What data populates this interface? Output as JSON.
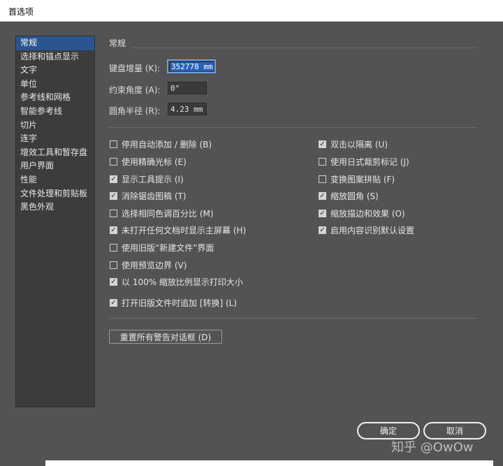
{
  "window": {
    "title": "首选项"
  },
  "sidebar": {
    "items": [
      {
        "label": "常规",
        "selected": true
      },
      {
        "label": "选择和锚点显示"
      },
      {
        "label": "文字"
      },
      {
        "label": "单位"
      },
      {
        "label": "参考线和网格"
      },
      {
        "label": "智能参考线"
      },
      {
        "label": "切片"
      },
      {
        "label": "连字"
      },
      {
        "label": "增效工具和暂存盘"
      },
      {
        "label": "用户界面"
      },
      {
        "label": "性能"
      },
      {
        "label": "文件处理和剪贴板"
      },
      {
        "label": "黑色外观"
      }
    ]
  },
  "main": {
    "section_title": "常规",
    "keyboard_increment": {
      "label": "键盘增量 (K):",
      "value": "352778 mm"
    },
    "constrain_angle": {
      "label": "约束角度 (A):",
      "value": "0°"
    },
    "corner_radius": {
      "label": "圆角半径 (R):",
      "value": "4.23 mm"
    },
    "options_left": [
      {
        "label": "停用自动添加 / 删除 (B)",
        "checked": false
      },
      {
        "label": "使用精确光标 (E)",
        "checked": false
      },
      {
        "label": "显示工具提示 (I)",
        "checked": true
      },
      {
        "label": "消除锯齿图稿 (T)",
        "checked": true
      },
      {
        "label": "选择相同色调百分比 (M)",
        "checked": false
      },
      {
        "label": "未打开任何文档时显示主屏幕 (H)",
        "checked": true
      },
      {
        "label": "使用旧版“新建文件”界面",
        "checked": false
      },
      {
        "label": "使用预览边界 (V)",
        "checked": false
      },
      {
        "label": "以 100% 缩放比例显示打印大小",
        "checked": true
      },
      {
        "label": "打开旧版文件时追加 [转换] (L)",
        "checked": true
      }
    ],
    "options_right": [
      {
        "label": "双击以隔离 (U)",
        "checked": true
      },
      {
        "label": "使用日式裁剪标记 (J)",
        "checked": false
      },
      {
        "label": "变换图案拼贴 (F)",
        "checked": false
      },
      {
        "label": "缩放圆角 (S)",
        "checked": true
      },
      {
        "label": "缩放描边和效果 (O)",
        "checked": true
      },
      {
        "label": "启用内容识别默认设置",
        "checked": true
      }
    ],
    "reset_warnings_label": "重置所有警告对话框 (D)"
  },
  "footer": {
    "ok_label": "确定",
    "cancel_label": "取消"
  },
  "watermark": "知乎 @OwOw"
}
